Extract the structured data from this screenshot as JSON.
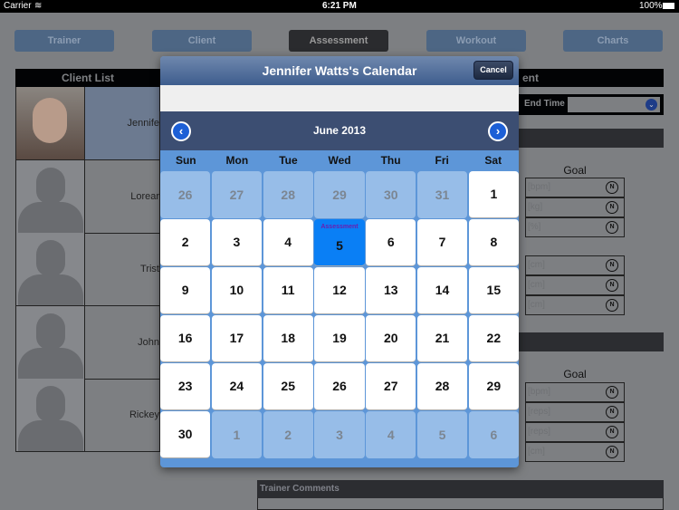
{
  "status_bar": {
    "carrier": "Carrier",
    "time": "6:21 PM",
    "battery": "100%"
  },
  "tabs": [
    {
      "label": "Trainer"
    },
    {
      "label": "Client"
    },
    {
      "label": "Assessment",
      "active": true
    },
    {
      "label": "Workout"
    },
    {
      "label": "Charts"
    }
  ],
  "client_list": {
    "header": "Client List",
    "clients": [
      {
        "name": "Jennife",
        "selected": true
      },
      {
        "name": "Lorear"
      },
      {
        "name": "Trist"
      },
      {
        "name": "John"
      },
      {
        "name": "Rickey"
      }
    ]
  },
  "right_panel": {
    "header": "ent",
    "end_time_label": "End Time",
    "goal_label": "Goal",
    "group1": [
      "[bpm]",
      "[kg]",
      "[%]"
    ],
    "group2": [
      "[cm]",
      "[cm]",
      "[cm]"
    ],
    "group3": [
      "[bpm]",
      "[reps]",
      "[reps]",
      "[cm]"
    ],
    "n_button": "N",
    "trainer_comments": "Trainer Comments"
  },
  "calendar": {
    "title": "Jennifer Watts's Calendar",
    "cancel": "Cancel",
    "month": "June 2013",
    "weekdays": [
      "Sun",
      "Mon",
      "Tue",
      "Wed",
      "Thu",
      "Fri",
      "Sat"
    ],
    "days": [
      {
        "d": "26",
        "o": 1
      },
      {
        "d": "27",
        "o": 1
      },
      {
        "d": "28",
        "o": 1
      },
      {
        "d": "29",
        "o": 1
      },
      {
        "d": "30",
        "o": 1
      },
      {
        "d": "31",
        "o": 1
      },
      {
        "d": "1"
      },
      {
        "d": "2"
      },
      {
        "d": "3"
      },
      {
        "d": "4"
      },
      {
        "d": "5",
        "sel": 1,
        "event": "Assessment"
      },
      {
        "d": "6"
      },
      {
        "d": "7"
      },
      {
        "d": "8"
      },
      {
        "d": "9"
      },
      {
        "d": "10"
      },
      {
        "d": "11"
      },
      {
        "d": "12"
      },
      {
        "d": "13"
      },
      {
        "d": "14"
      },
      {
        "d": "15"
      },
      {
        "d": "16"
      },
      {
        "d": "17"
      },
      {
        "d": "18"
      },
      {
        "d": "19"
      },
      {
        "d": "20"
      },
      {
        "d": "21"
      },
      {
        "d": "22"
      },
      {
        "d": "23"
      },
      {
        "d": "24"
      },
      {
        "d": "25"
      },
      {
        "d": "26"
      },
      {
        "d": "27"
      },
      {
        "d": "28"
      },
      {
        "d": "29"
      },
      {
        "d": "30"
      },
      {
        "d": "1",
        "o": 1
      },
      {
        "d": "2",
        "o": 1
      },
      {
        "d": "3",
        "o": 1
      },
      {
        "d": "4",
        "o": 1
      },
      {
        "d": "5",
        "o": 1
      },
      {
        "d": "6",
        "o": 1
      }
    ]
  }
}
